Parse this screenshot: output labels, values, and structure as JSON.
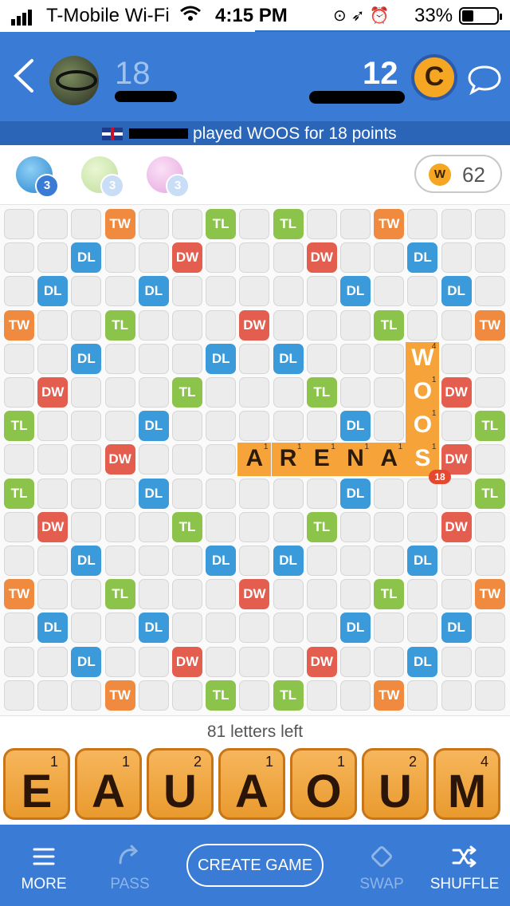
{
  "status_bar": {
    "carrier": "T-Mobile Wi-Fi",
    "time": "4:15 PM",
    "battery": "33%"
  },
  "header": {
    "left_score": "18",
    "right_score": "12",
    "coin_letter": "C"
  },
  "banner": {
    "text": "played WOOS for 18 points"
  },
  "powerups": {
    "first_count": "3",
    "second_count": "3",
    "third_count": "3",
    "coins": "62",
    "coin_symbol": "W"
  },
  "board": {
    "size": 15,
    "bonus_labels": [
      "TW",
      "TL",
      "DW",
      "DL"
    ],
    "played_words": [
      {
        "word": "ARENA",
        "direction": "across",
        "row": 7,
        "col": 7
      },
      {
        "word": "WOOS",
        "direction": "down",
        "row": 4,
        "col": 12
      }
    ],
    "last_move_score": "18"
  },
  "letters_left": "81 letters left",
  "rack": [
    {
      "letter": "E",
      "points": "1"
    },
    {
      "letter": "A",
      "points": "1"
    },
    {
      "letter": "U",
      "points": "2"
    },
    {
      "letter": "A",
      "points": "1"
    },
    {
      "letter": "O",
      "points": "1"
    },
    {
      "letter": "U",
      "points": "2"
    },
    {
      "letter": "M",
      "points": "4"
    }
  ],
  "bottom_bar": {
    "more": "MORE",
    "pass": "PASS",
    "create_game": "CREATE GAME",
    "swap": "SWAP",
    "shuffle": "SHUFFLE"
  },
  "colors": {
    "header_blue": "#3a7bd5",
    "tile_orange": "#f6a43a",
    "tw": "#f08a3e",
    "tl": "#8cc34a",
    "dw": "#e45e4f",
    "dl": "#3b9ad9"
  }
}
